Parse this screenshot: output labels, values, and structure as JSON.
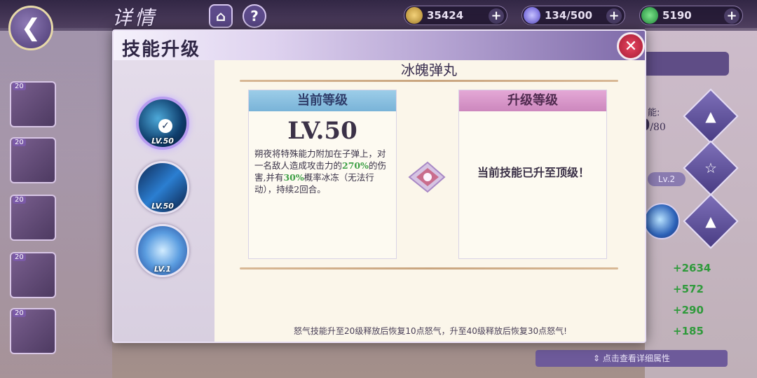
{
  "top": {
    "title": "详情",
    "resources": {
      "gold": "35424",
      "stamina": "134/500",
      "gem": "5190"
    }
  },
  "modal": {
    "title": "技能升级",
    "skill_name": "冰魄弹丸",
    "skills": [
      {
        "level": "LV.50",
        "selected": true
      },
      {
        "level": "LV.50",
        "selected": false
      },
      {
        "level": "LV.1",
        "selected": false
      }
    ],
    "current": {
      "header": "当前等级",
      "level": "LV.50",
      "desc_parts": [
        "朔夜将特殊能力附加在子弹上，对一名敌人造成攻击力的",
        "270%",
        "的伤害,并有",
        "30%",
        "概率冰冻（无法行动），持续2回合。"
      ]
    },
    "next": {
      "header": "升级等级",
      "text": "当前技能已升至顶级！"
    },
    "footer": "怒气技能升至20级释放后恢复10点怒气，升至40级释放后恢复30点怒气!"
  },
  "equip_slots": [
    "20",
    "20",
    "20",
    "20",
    "20"
  ],
  "right_panel": {
    "cap": "能:",
    "value": "0",
    "max": "/80",
    "lv_tag": "Lv.2",
    "stats": [
      "+2634",
      "+572",
      "+290",
      "+185"
    ],
    "detail_button": "点击查看详细属性"
  },
  "colors": {
    "accent_purple": "#7d69a8",
    "highlight_green": "#3ea046",
    "close_red": "#c42a45"
  }
}
